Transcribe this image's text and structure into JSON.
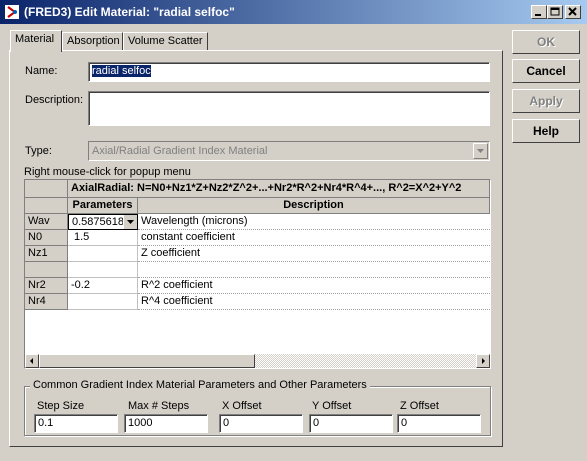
{
  "window": {
    "title": "(FRED3) Edit Material: \"radial selfoc\""
  },
  "tabs": [
    {
      "label": "Material"
    },
    {
      "label": "Absorption"
    },
    {
      "label": "Volume Scatter"
    }
  ],
  "side_buttons": {
    "ok": "OK",
    "cancel": "Cancel",
    "apply": "Apply",
    "help": "Help"
  },
  "form": {
    "name_label": "Name:",
    "name_value": "radial selfoc",
    "description_label": "Description:",
    "description_value": "",
    "type_label": "Type:",
    "type_value": "Axial/Radial Gradient Index Material",
    "hint": "Right mouse-click for popup menu"
  },
  "table": {
    "formula_header": "AxialRadial:  N=N0+Nz1*Z+Nz2*Z^2+...+Nr2*R^2+Nr4*R^4+...,    R^2=X^2+Y^2",
    "col_params": "Parameters",
    "col_desc": "Description",
    "rows": [
      {
        "name": "Wav",
        "param": "0.5875618",
        "desc": "Wavelength (microns)"
      },
      {
        "name": "N0",
        "param": "1.5",
        "desc": "constant coefficient"
      },
      {
        "name": "Nz1",
        "param": "",
        "desc": "Z coefficient"
      },
      {
        "name": "",
        "param": "",
        "desc": ""
      },
      {
        "name": "Nr2",
        "param": "-0.2",
        "desc": "R^2 coefficient"
      },
      {
        "name": "Nr4",
        "param": "",
        "desc": "R^4 coefficient"
      }
    ]
  },
  "common": {
    "title": "Common Gradient Index Material Parameters and Other Parameters",
    "fields": [
      {
        "label": "Step Size",
        "value": "0.1"
      },
      {
        "label": "Max # Steps",
        "value": "1000"
      },
      {
        "label": "X Offset",
        "value": "0"
      },
      {
        "label": "Y Offset",
        "value": "0"
      },
      {
        "label": "Z Offset",
        "value": "0"
      }
    ]
  },
  "colors": {
    "titlebar_start": "#0a246a",
    "titlebar_end": "#a6caf0",
    "face": "#d4d0c8"
  }
}
